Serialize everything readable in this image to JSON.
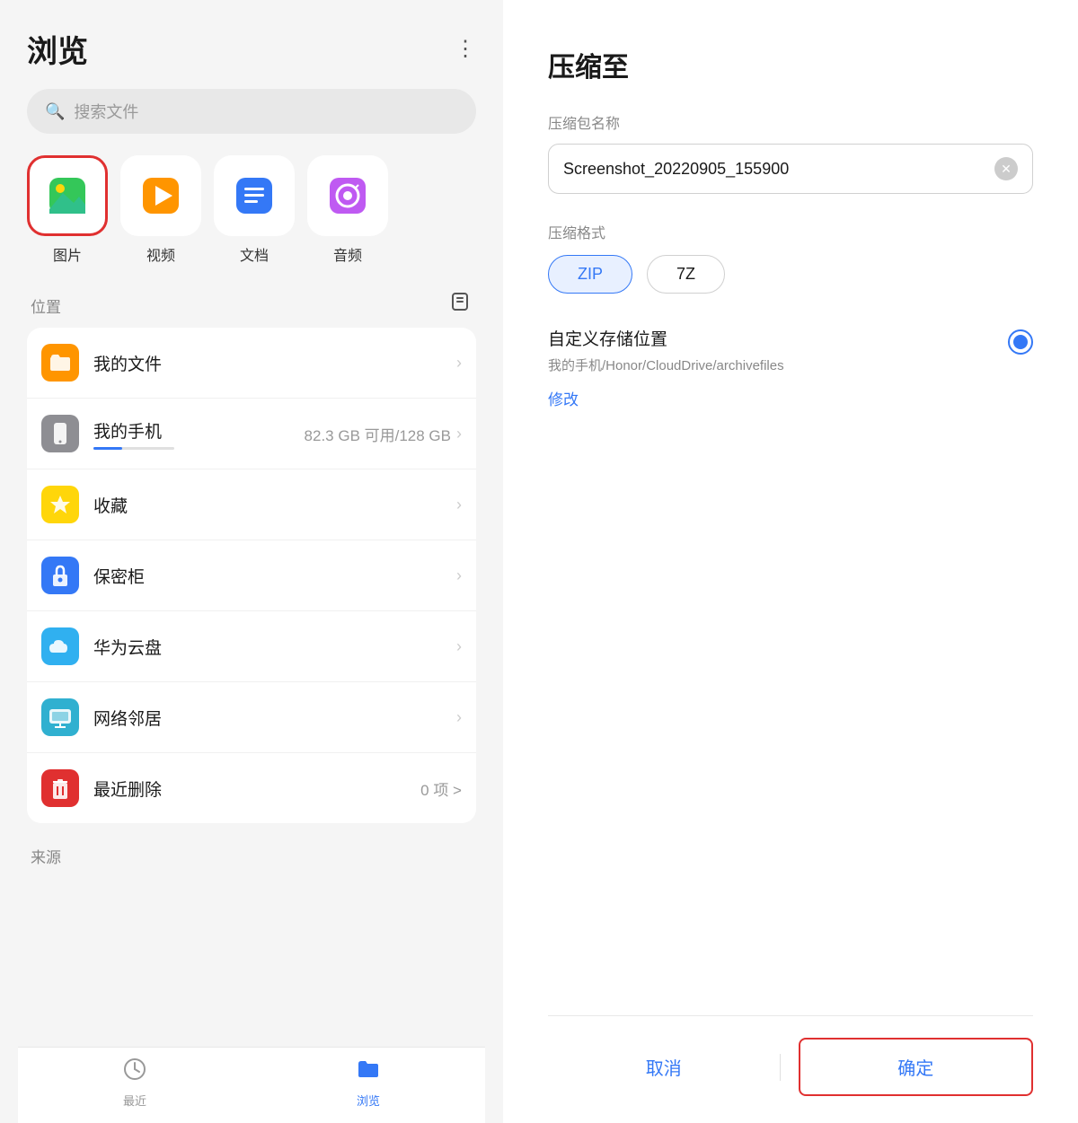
{
  "left": {
    "title": "浏览",
    "search_placeholder": "搜索文件",
    "categories": [
      {
        "id": "images",
        "label": "图片",
        "emoji": "🖼️",
        "selected": true
      },
      {
        "id": "video",
        "label": "视频",
        "emoji": "▶️",
        "selected": false
      },
      {
        "id": "docs",
        "label": "文档",
        "emoji": "📄",
        "selected": false
      },
      {
        "id": "audio",
        "label": "音频",
        "emoji": "🎵",
        "selected": false
      }
    ],
    "location_section": "位置",
    "location_items": [
      {
        "id": "my-files",
        "name": "我的文件",
        "sub": "",
        "icon_color": "orange",
        "icon": "📁",
        "right": ">"
      },
      {
        "id": "my-phone",
        "name": "我的手机",
        "sub": "82.3 GB 可用/128 GB",
        "icon_color": "gray",
        "icon": "📱",
        "right": ">",
        "has_bar": true
      },
      {
        "id": "favorites",
        "name": "收藏",
        "sub": "",
        "icon_color": "yellow",
        "icon": "⭐",
        "right": ">"
      },
      {
        "id": "safe",
        "name": "保密柜",
        "sub": "",
        "icon_color": "blue-dark",
        "icon": "🔒",
        "right": ">"
      },
      {
        "id": "huawei-cloud",
        "name": "华为云盘",
        "sub": "",
        "icon_color": "blue-light",
        "icon": "☁️",
        "right": ">"
      },
      {
        "id": "network",
        "name": "网络邻居",
        "sub": "",
        "icon_color": "teal",
        "icon": "🖥️",
        "right": ">"
      },
      {
        "id": "recently-deleted",
        "name": "最近删除",
        "sub": "",
        "icon_color": "red",
        "icon": "🗑️",
        "right": "0 项 >"
      }
    ],
    "source_section": "来源",
    "tabs": [
      {
        "id": "recent",
        "label": "最近",
        "active": false
      },
      {
        "id": "browse",
        "label": "浏览",
        "active": true
      }
    ]
  },
  "right": {
    "title": "压缩至",
    "name_label": "压缩包名称",
    "name_value": "Screenshot_20220905_155900",
    "format_label": "压缩格式",
    "formats": [
      {
        "id": "zip",
        "label": "ZIP",
        "active": true
      },
      {
        "id": "7z",
        "label": "7Z",
        "active": false
      }
    ],
    "custom_storage_title": "自定义存储位置",
    "custom_storage_path": "我的手机/Honor/CloudDrive/archivefiles",
    "modify_label": "修改",
    "cancel_label": "取消",
    "confirm_label": "确定"
  }
}
